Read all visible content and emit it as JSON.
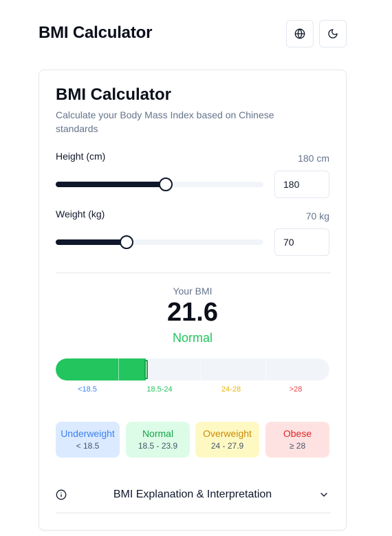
{
  "header": {
    "title": "BMI Calculator"
  },
  "card": {
    "title": "BMI Calculator",
    "description": "Calculate your Body Mass Index based on Chinese standards"
  },
  "height": {
    "label": "Height (cm)",
    "display": "180 cm",
    "value": "180",
    "slider_fraction": 0.53
  },
  "weight": {
    "label": "Weight (kg)",
    "display": "70 kg",
    "value": "70",
    "slider_fraction": 0.34
  },
  "result": {
    "caption": "Your BMI",
    "value": "21.6",
    "status": "Normal",
    "status_color": "#22c55e"
  },
  "scale": {
    "labels": [
      {
        "text": "<18.5",
        "color": "#3b82f6"
      },
      {
        "text": "18.5-24",
        "color": "#22c55e"
      },
      {
        "text": "24-28",
        "color": "#eab308"
      },
      {
        "text": ">28",
        "color": "#ef4444"
      }
    ],
    "fill_fraction": 0.33
  },
  "categories": [
    {
      "name": "Underweight",
      "range": "< 18.5",
      "bg": "#dbeafe",
      "color": "#3b82f6"
    },
    {
      "name": "Normal",
      "range": "18.5 - 23.9",
      "bg": "#dcfce7",
      "color": "#16a34a"
    },
    {
      "name": "Overweight",
      "range": "24 - 27.9",
      "bg": "#fef9c3",
      "color": "#ca8a04"
    },
    {
      "name": "Obese",
      "range": "≥ 28",
      "bg": "#fee2e2",
      "color": "#dc2626"
    }
  ],
  "accordion": {
    "label": "BMI Explanation & Interpretation"
  },
  "icons": {
    "language": "globe-icon",
    "theme": "moon-icon",
    "info": "info-icon",
    "expand": "chevron-down-icon"
  }
}
